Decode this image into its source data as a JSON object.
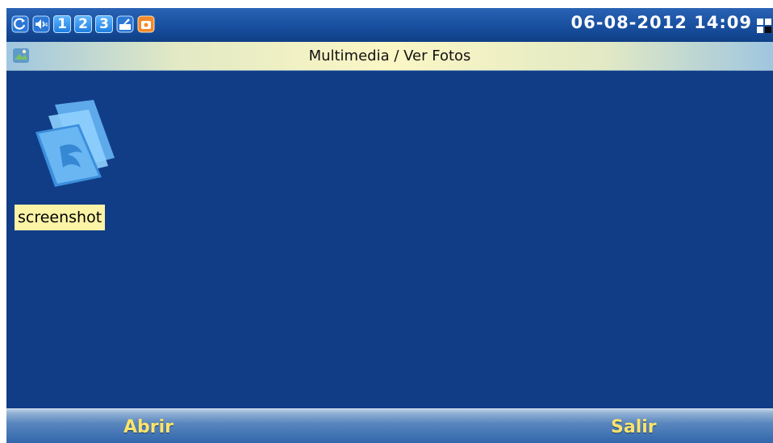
{
  "status_bar": {
    "icons": [
      "refresh-icon",
      "volume-icon",
      "line-1-icon",
      "line-2-icon",
      "line-3-icon",
      "edit-icon",
      "missed-call-icon"
    ],
    "lines": [
      "1",
      "2",
      "3"
    ],
    "datetime": "06-08-2012 14:09",
    "signal_icon": "network-status-icon"
  },
  "title_bar": {
    "icon": "photo-icon",
    "title": "Multimedia / Ver Fotos"
  },
  "content": {
    "items": [
      {
        "icon": "folder-icon",
        "label": "screenshot",
        "selected": true
      }
    ]
  },
  "softkeys": {
    "left": "Abrir",
    "right": "Salir"
  },
  "colors": {
    "background": "#113d87",
    "selection": "#fbf3a6",
    "softkey_text": "#ffe36a"
  }
}
